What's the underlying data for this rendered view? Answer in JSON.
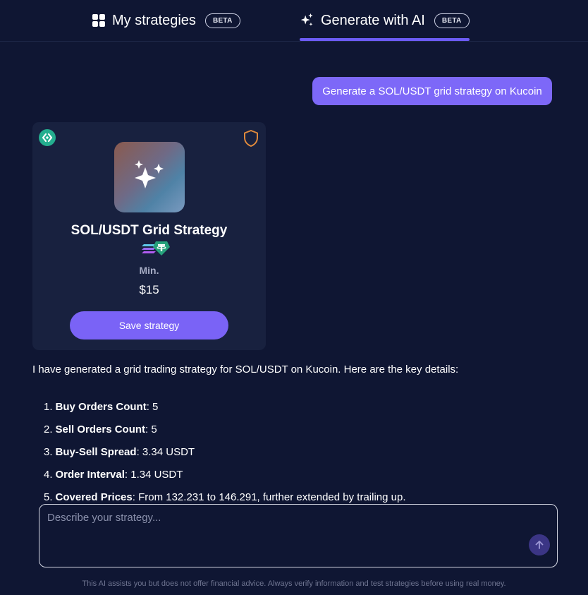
{
  "tabs": [
    {
      "label": "My strategies",
      "badge": "BETA",
      "icon": "grid-icon",
      "active": false
    },
    {
      "label": "Generate with AI",
      "badge": "BETA",
      "icon": "sparkles-icon",
      "active": true
    }
  ],
  "chat": {
    "user_message": "Generate a SOL/USDT grid strategy on Kucoin"
  },
  "card": {
    "exchange_icon": "kucoin-logo-icon",
    "badge_icon": "shield-icon",
    "title": "SOL/USDT Grid Strategy",
    "coins": [
      "SOL",
      "USDT"
    ],
    "min_label": "Min.",
    "min_value": "$15",
    "save_label": "Save strategy"
  },
  "response": {
    "intro": "I have generated a grid trading strategy for SOL/USDT on Kucoin. Here are the key details:",
    "details": [
      {
        "num": "1.",
        "key": "Buy Orders Count",
        "value": ": 5"
      },
      {
        "num": "2.",
        "key": "Sell Orders Count",
        "value": ": 5"
      },
      {
        "num": "3.",
        "key": "Buy-Sell Spread",
        "value": ": 3.34 USDT"
      },
      {
        "num": "4.",
        "key": "Order Interval",
        "value": ": 1.34 USDT"
      },
      {
        "num": "5.",
        "key": "Covered Prices",
        "value": ": From 132.231 to 146.291, further extended by trailing up."
      }
    ]
  },
  "input": {
    "placeholder": "Describe your strategy...",
    "value": ""
  },
  "disclaimer": "This AI assists you but does not offer financial advice. Always verify information and test strategies before using real money.",
  "colors": {
    "background": "#0f1633",
    "card": "#18213f",
    "accent": "#7a63f6",
    "user_bubble": "#7d68f8"
  }
}
